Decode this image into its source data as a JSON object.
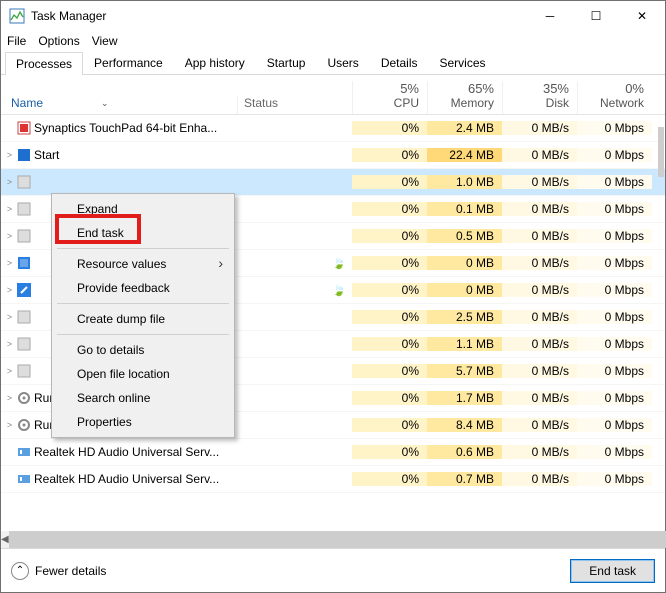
{
  "window": {
    "title": "Task Manager"
  },
  "menubar": [
    "File",
    "Options",
    "View"
  ],
  "tabs": [
    "Processes",
    "Performance",
    "App history",
    "Startup",
    "Users",
    "Details",
    "Services"
  ],
  "active_tab": 0,
  "columns": {
    "name": "Name",
    "status": "Status",
    "metrics": [
      {
        "pct": "5%",
        "label": "CPU"
      },
      {
        "pct": "65%",
        "label": "Memory"
      },
      {
        "pct": "35%",
        "label": "Disk"
      },
      {
        "pct": "0%",
        "label": "Network"
      }
    ]
  },
  "rows": [
    {
      "exp": "",
      "icon": "red-square",
      "name": "Synaptics TouchPad 64-bit Enha...",
      "status": "",
      "cpu": "0%",
      "mem": "2.4 MB",
      "disk": "0 MB/s",
      "net": "0 Mbps"
    },
    {
      "exp": ">",
      "icon": "blue-square",
      "name": "Start",
      "status": "",
      "cpu": "0%",
      "mem": "22.4 MB",
      "disk": "0 MB/s",
      "net": "0 Mbps"
    },
    {
      "exp": ">",
      "icon": "app",
      "name": "",
      "status": "",
      "cpu": "0%",
      "mem": "1.0 MB",
      "disk": "0 MB/s",
      "net": "0 Mbps",
      "selected": true
    },
    {
      "exp": ">",
      "icon": "app",
      "name": "",
      "status": "",
      "cpu": "0%",
      "mem": "0.1 MB",
      "disk": "0 MB/s",
      "net": "0 Mbps"
    },
    {
      "exp": ">",
      "icon": "app",
      "name": "",
      "status": "",
      "cpu": "0%",
      "mem": "0.5 MB",
      "disk": "0 MB/s",
      "net": "0 Mbps"
    },
    {
      "exp": ">",
      "icon": "blue-sq2",
      "name": "",
      "status": "leaf",
      "cpu": "0%",
      "mem": "0 MB",
      "disk": "0 MB/s",
      "net": "0 Mbps"
    },
    {
      "exp": ">",
      "icon": "blue-wrench",
      "name": "",
      "status": "leaf",
      "cpu": "0%",
      "mem": "0 MB",
      "disk": "0 MB/s",
      "net": "0 Mbps"
    },
    {
      "exp": ">",
      "icon": "app",
      "name": "",
      "status": "",
      "cpu": "0%",
      "mem": "2.5 MB",
      "disk": "0 MB/s",
      "net": "0 Mbps"
    },
    {
      "exp": ">",
      "icon": "app",
      "name": "",
      "status": "",
      "cpu": "0%",
      "mem": "1.1 MB",
      "disk": "0 MB/s",
      "net": "0 Mbps"
    },
    {
      "exp": ">",
      "icon": "app",
      "name": "",
      "status": "",
      "cpu": "0%",
      "mem": "5.7 MB",
      "disk": "0 MB/s",
      "net": "0 Mbps"
    },
    {
      "exp": ">",
      "icon": "gear",
      "name": "Runtime Broker",
      "status": "",
      "cpu": "0%",
      "mem": "1.7 MB",
      "disk": "0 MB/s",
      "net": "0 Mbps"
    },
    {
      "exp": ">",
      "icon": "gear",
      "name": "Runtime Broker",
      "status": "",
      "cpu": "0%",
      "mem": "8.4 MB",
      "disk": "0 MB/s",
      "net": "0 Mbps"
    },
    {
      "exp": "",
      "icon": "realtek",
      "name": "Realtek HD Audio Universal Serv...",
      "status": "",
      "cpu": "0%",
      "mem": "0.6 MB",
      "disk": "0 MB/s",
      "net": "0 Mbps"
    },
    {
      "exp": "",
      "icon": "realtek",
      "name": "Realtek HD Audio Universal Serv...",
      "status": "",
      "cpu": "0%",
      "mem": "0.7 MB",
      "disk": "0 MB/s",
      "net": "0 Mbps"
    }
  ],
  "context_menu": {
    "items": [
      {
        "label": "Expand",
        "type": "item"
      },
      {
        "label": "End task",
        "type": "item",
        "highlighted": true
      },
      {
        "type": "sep"
      },
      {
        "label": "Resource values",
        "type": "submenu"
      },
      {
        "label": "Provide feedback",
        "type": "item"
      },
      {
        "type": "sep"
      },
      {
        "label": "Create dump file",
        "type": "item"
      },
      {
        "type": "sep"
      },
      {
        "label": "Go to details",
        "type": "item"
      },
      {
        "label": "Open file location",
        "type": "item"
      },
      {
        "label": "Search online",
        "type": "item"
      },
      {
        "label": "Properties",
        "type": "item"
      }
    ]
  },
  "footer": {
    "fewer": "Fewer details",
    "end_task": "End task"
  }
}
